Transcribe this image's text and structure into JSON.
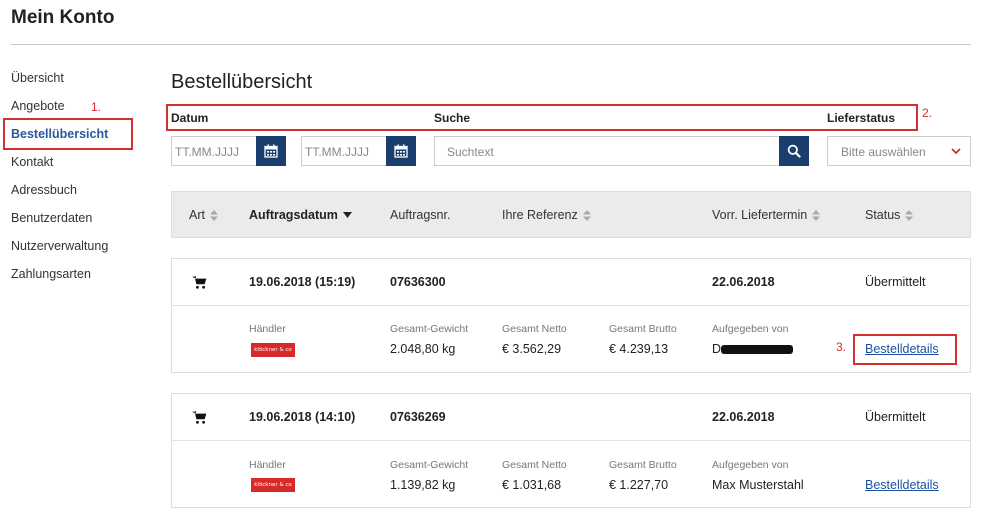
{
  "page_title": "Mein Konto",
  "sidebar": {
    "items": [
      {
        "label": "Übersicht"
      },
      {
        "label": "Angebote"
      },
      {
        "label": "Bestellübersicht"
      },
      {
        "label": "Kontakt"
      },
      {
        "label": "Adressbuch"
      },
      {
        "label": "Benutzerdaten"
      },
      {
        "label": "Nutzerverwaltung"
      },
      {
        "label": "Zahlungsarten"
      }
    ],
    "active_index": 2
  },
  "annotations": {
    "n1": "1.",
    "n2": "2.",
    "n3": "3."
  },
  "main": {
    "title": "Bestellübersicht",
    "filters": {
      "date_label": "Datum",
      "search_label": "Suche",
      "status_label": "Lieferstatus",
      "date_from_placeholder": "TT.MM.JJJJ",
      "date_to_placeholder": "TT.MM.JJJJ",
      "search_placeholder": "Suchtext",
      "status_placeholder": "Bitte auswählen"
    },
    "table": {
      "columns": {
        "art": "Art",
        "auftragsdatum": "Auftragsdatum",
        "auftragsnr": "Auftragsnr.",
        "referenz": "Ihre Referenz",
        "liefertermin": "Vorr. Liefertermin",
        "status": "Status"
      }
    },
    "detail_labels": {
      "haendler": "Händler",
      "gewicht": "Gesamt-Gewicht",
      "netto": "Gesamt Netto",
      "brutto": "Gesamt Brutto",
      "aufgegeben": "Aufgegeben von"
    },
    "orders": [
      {
        "date": "19.06.2018 (15:19)",
        "number": "07636300",
        "reference": "",
        "delivery": "22.06.2018",
        "status": "Übermittelt",
        "merchant_logo": "klöckner & co",
        "weight": "2.048,80 kg",
        "net": "€ 3.562,29",
        "gross": "€ 4.239,13",
        "placed_by": "D",
        "details_link": "Bestelldetails"
      },
      {
        "date": "19.06.2018 (14:10)",
        "number": "07636269",
        "reference": "",
        "delivery": "22.06.2018",
        "status": "Übermittelt",
        "merchant_logo": "klöckner & co",
        "weight": "1.139,82 kg",
        "net": "€ 1.031,68",
        "gross": "€ 1.227,70",
        "placed_by": "Max Musterstahl",
        "details_link": "Bestelldetails"
      }
    ]
  },
  "colors": {
    "accent": "#1a3f6f",
    "annotation": "#d32f2f",
    "link": "#1f4fa0",
    "header_bg": "#ebebeb"
  }
}
